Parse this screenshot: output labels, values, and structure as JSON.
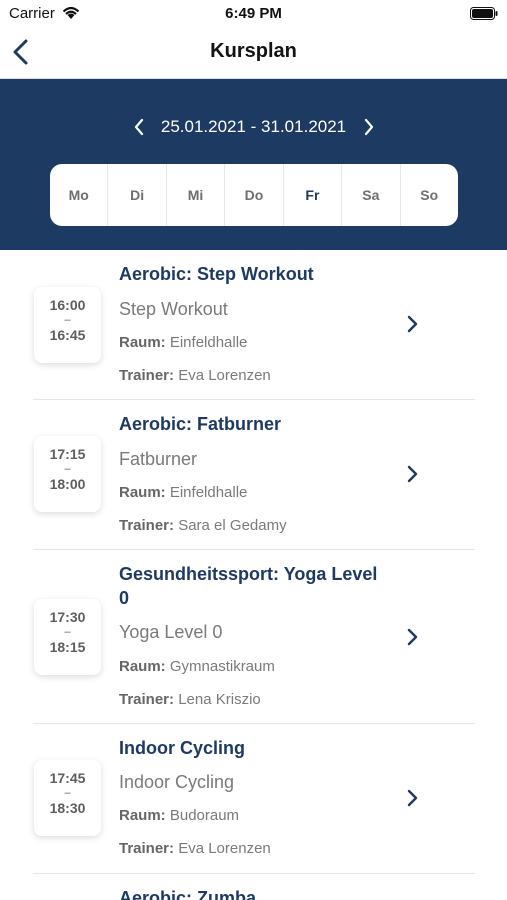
{
  "status_bar": {
    "carrier": "Carrier",
    "time": "6:49 PM"
  },
  "nav": {
    "title": "Kursplan"
  },
  "week": {
    "range": "25.01.2021 - 31.01.2021"
  },
  "days": [
    {
      "label": "Mo",
      "active": false
    },
    {
      "label": "Di",
      "active": false
    },
    {
      "label": "Mi",
      "active": false
    },
    {
      "label": "Do",
      "active": false
    },
    {
      "label": "Fr",
      "active": true
    },
    {
      "label": "Sa",
      "active": false
    },
    {
      "label": "So",
      "active": false
    }
  ],
  "labels": {
    "room": "Raum:",
    "trainer": "Trainer:",
    "dash": "–"
  },
  "courses": [
    {
      "title": "Aerobic: Step Workout",
      "subtitle": "Step Workout",
      "room": "Einfeldhalle",
      "trainer": "Eva Lorenzen",
      "start": "16:00",
      "end": "16:45"
    },
    {
      "title": "Aerobic: Fatburner",
      "subtitle": "Fatburner",
      "room": "Einfeldhalle",
      "trainer": "Sara el Gedamy",
      "start": "17:15",
      "end": "18:00"
    },
    {
      "title": "Gesundheitssport: Yoga Level 0",
      "subtitle": "Yoga Level 0",
      "room": "Gymnastikraum",
      "trainer": "Lena Kriszio",
      "start": "17:30",
      "end": "18:15"
    },
    {
      "title": "Indoor Cycling",
      "subtitle": "Indoor Cycling",
      "room": "Budoraum",
      "trainer": "Eva Lorenzen",
      "start": "17:45",
      "end": "18:30"
    },
    {
      "title": "Aerobic: Zumba"
    }
  ],
  "colors": {
    "header_bg": "#1d3a63",
    "title_text": "#1d3a63",
    "muted_text": "#7a7a7a"
  }
}
